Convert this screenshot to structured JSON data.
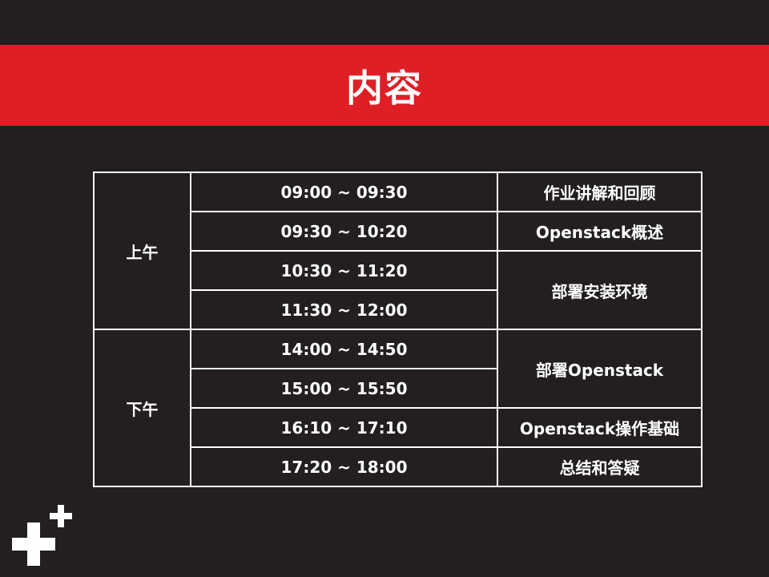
{
  "title": "内容",
  "schedule": {
    "sessions": [
      {
        "period": "上午",
        "rows": [
          {
            "time": "09:00 ~ 09:30",
            "topic": "作业讲解和回顾",
            "span": 1
          },
          {
            "time": "09:30 ~ 10:20",
            "topic": "Openstack概述",
            "span": 1
          },
          {
            "time": "10:30 ~ 11:20",
            "topic": "部署安装环境",
            "span": 2
          },
          {
            "time": "11:30 ~ 12:00",
            "topic": null,
            "span": 0
          }
        ]
      },
      {
        "period": "下午",
        "rows": [
          {
            "time": "14:00 ~ 14:50",
            "topic": "部署Openstack",
            "span": 2
          },
          {
            "time": "15:00 ~ 15:50",
            "topic": null,
            "span": 0
          },
          {
            "time": "16:10 ~ 17:10",
            "topic": "Openstack操作基础",
            "span": 1
          },
          {
            "time": "17:20 ~ 18:00",
            "topic": "总结和答疑",
            "span": 1
          }
        ]
      }
    ]
  },
  "logo": {
    "icon": "plus-plus-icon",
    "color": "#ffffff"
  },
  "colors": {
    "background": "#231f20",
    "accent": "#de1f26",
    "text": "#ffffff"
  }
}
